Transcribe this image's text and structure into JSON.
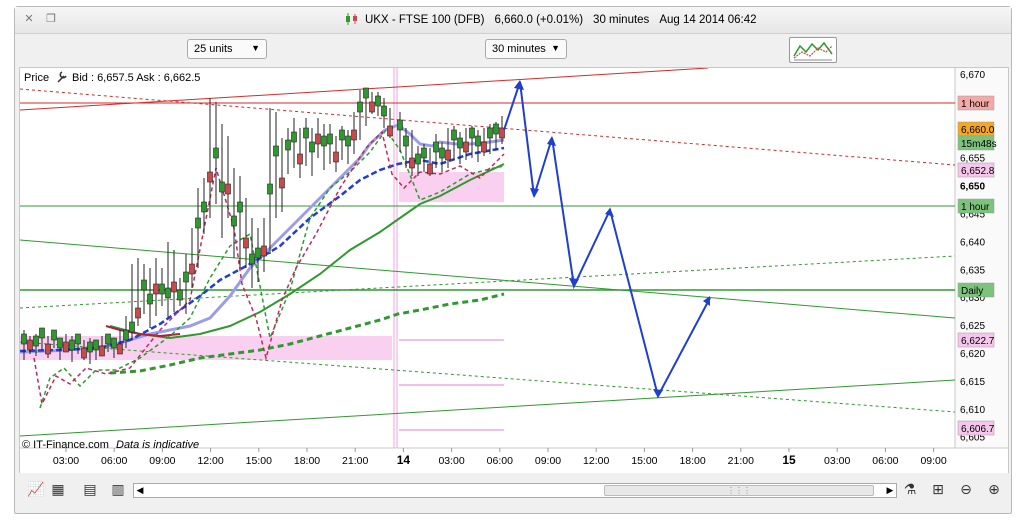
{
  "window": {
    "instrument": "UKX - FTSE 100 (DFB)",
    "price_change": "6,660.0 (+0.01%)",
    "interval": "30 minutes",
    "datetime": "Aug 14 2014 06:42"
  },
  "toolbar": {
    "units_combo": "25 units",
    "interval_combo": "30 minutes"
  },
  "chart": {
    "price_label": "Price",
    "bid_ask": "Bid : 6,657.5 Ask : 6,662.5",
    "watermark": "© IT-Finance.com",
    "disclaimer": "Data is indicative",
    "y_axis": {
      "ticks": [
        "6,670",
        "6,665",
        "6,660",
        "6,655",
        "6,650",
        "6,645",
        "6,640",
        "6,635",
        "6,630",
        "6,625",
        "6,620",
        "6,615",
        "6,610",
        "6,605"
      ],
      "bold_tick": "6,650"
    },
    "markers": [
      {
        "text": "1 hour",
        "bg": "#f4a9a9"
      },
      {
        "text": "6,660.0",
        "bg": "#f5a623"
      },
      {
        "text": "15m48s",
        "bg": "#7cc47c"
      },
      {
        "text": "6,652.8",
        "bg": "#f7c6ec"
      },
      {
        "text": "1 hour",
        "bg": "#7cc47c"
      },
      {
        "text": "Daily",
        "bg": "#7cc47c"
      },
      {
        "text": "6,622.7",
        "bg": "#f7c6ec"
      },
      {
        "text": "6,606.7",
        "bg": "#f7c6ec"
      }
    ],
    "x_axis": [
      "03:00",
      "06:00",
      "09:00",
      "12:00",
      "15:00",
      "18:00",
      "21:00",
      "14",
      "03:00",
      "06:00",
      "09:00",
      "12:00",
      "15:00",
      "18:00",
      "21:00",
      "15",
      "03:00",
      "06:00",
      "09:00"
    ],
    "x_bold": [
      "14",
      "15"
    ],
    "colors": {
      "up_candle": "#2e9a2e",
      "down_candle": "#c94a4a",
      "forecast_arrow": "#1f3fcf",
      "zone_pink": "#f9c8ef"
    }
  },
  "bottom": {
    "icons": [
      "add-indicator-icon",
      "color-picker-icon",
      "notes-icon",
      "stripes-icon"
    ],
    "zoom_icons": [
      "zoom-area-icon",
      "zoom-out-icon",
      "zoom-in-icon"
    ],
    "scroll_center": "⋮⋮⋮"
  }
}
